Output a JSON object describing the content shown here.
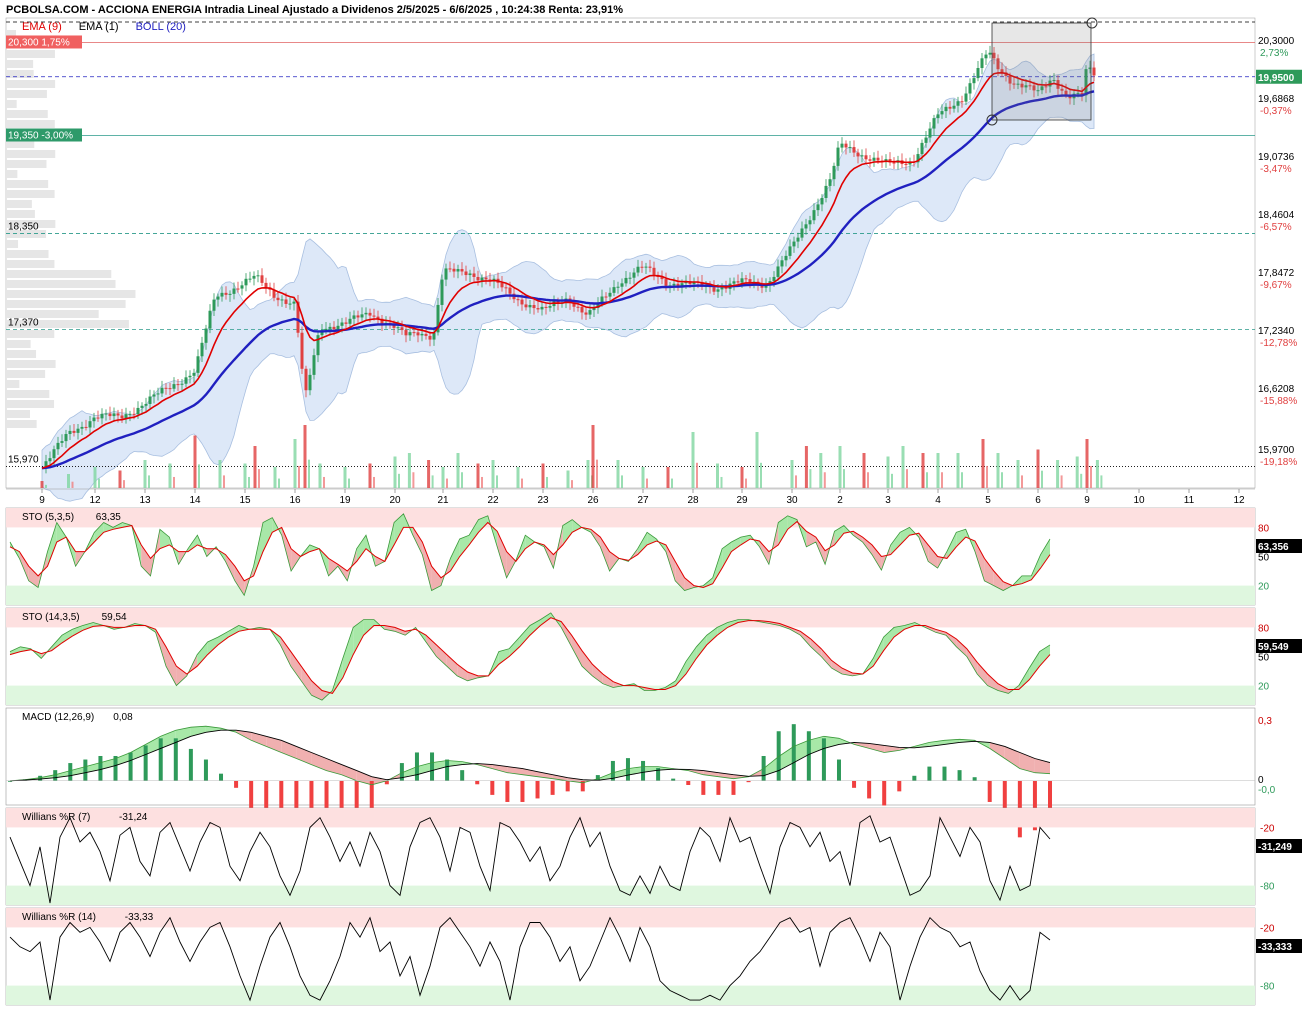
{
  "header": {
    "title": "PCBOLSA.COM - ACCIONA ENERGIA Intradia Lineal Ajustado a Dividenos 2/5/2025 - 6/6/2025 , 10:24:38 Renta: 23,91%"
  },
  "legend": [
    {
      "label": "EMA (9)",
      "color": "#e00000"
    },
    {
      "label": "EMA (1)",
      "color": "#000000"
    },
    {
      "label": "BOLL (20)",
      "color": "#2020c0"
    }
  ],
  "colors": {
    "up": "#2e9a5a",
    "down": "#e04040",
    "ema9": "#e00000",
    "ema_slow": "#2020c0",
    "boll_fill": "#dde8f8",
    "boll_edge": "#a8bfe0",
    "overbought": "#fde0e0",
    "oversold": "#dff7df",
    "grid_text": "#000000"
  },
  "chart_data": [
    {
      "type": "line",
      "name": "price",
      "ylim": [
        15.75,
        20.55
      ],
      "price_ticks": [
        "20,3000",
        "19,6868",
        "19,0736",
        "18,4604",
        "17,8472",
        "17,2340",
        "16,6208",
        "15,9700"
      ],
      "pct_ticks": [
        "2,73%",
        "-0,37%",
        "-3,47%",
        "-6,57%",
        "-9,67%",
        "-12,78%",
        "-15,88%",
        "-19,18%"
      ],
      "current_price": "19,9500",
      "x_labels": [
        "9",
        "12",
        "13",
        "14",
        "15",
        "16",
        "19",
        "20",
        "21",
        "22",
        "23",
        "26",
        "27",
        "28",
        "29",
        "30",
        "2",
        "3",
        "4",
        "5",
        "6",
        "9",
        "10",
        "11",
        "12"
      ],
      "left_levels": [
        {
          "label": "20,300  1,75%",
          "value": 20.3,
          "style": "red-solid"
        },
        {
          "label": "19,350  -3,00%",
          "value": 19.35,
          "style": "green-solid"
        },
        {
          "label": "18,350",
          "value": 18.35,
          "style": "dashed"
        },
        {
          "label": "17,370",
          "value": 17.37,
          "style": "dashed"
        },
        {
          "label": "15,970",
          "value": 15.97,
          "style": "dotted"
        }
      ],
      "closes": [
        [
          0,
          15.97
        ],
        [
          0.5,
          16.3
        ],
        [
          1,
          16.48
        ],
        [
          1.5,
          16.47
        ],
        [
          2,
          16.62
        ],
        [
          2.5,
          16.78
        ],
        [
          3,
          16.95
        ],
        [
          3.4,
          17.7
        ],
        [
          3.8,
          17.8
        ],
        [
          4.2,
          17.9
        ],
        [
          4.6,
          17.72
        ],
        [
          5,
          17.62
        ],
        [
          5.2,
          16.65
        ],
        [
          5.5,
          17.4
        ],
        [
          6,
          17.42
        ],
        [
          6.5,
          17.55
        ],
        [
          7,
          17.38
        ],
        [
          7.2,
          17.3
        ],
        [
          7.5,
          17.35
        ],
        [
          7.8,
          17.3
        ],
        [
          8,
          17.95
        ],
        [
          8.5,
          17.96
        ],
        [
          9,
          17.85
        ],
        [
          9.5,
          17.68
        ],
        [
          10,
          17.55
        ],
        [
          10.5,
          17.7
        ],
        [
          10.9,
          17.5
        ],
        [
          11,
          17.56
        ],
        [
          11.5,
          17.85
        ],
        [
          12,
          18.0
        ],
        [
          12.5,
          17.85
        ],
        [
          13,
          17.82
        ],
        [
          13.5,
          17.8
        ],
        [
          14,
          17.85
        ],
        [
          14.5,
          17.84
        ],
        [
          15,
          18.2
        ],
        [
          15.4,
          18.55
        ],
        [
          15.8,
          18.9
        ],
        [
          16,
          19.25
        ],
        [
          16.5,
          19.15
        ],
        [
          17,
          19.05
        ],
        [
          17.5,
          19.1
        ],
        [
          18,
          19.55
        ],
        [
          18.5,
          19.75
        ],
        [
          19,
          20.2
        ],
        [
          19.2,
          20.05
        ],
        [
          19.5,
          19.9
        ],
        [
          19.8,
          19.83
        ],
        [
          20,
          19.78
        ],
        [
          20.3,
          19.95
        ],
        [
          20.6,
          19.75
        ],
        [
          20.9,
          19.75
        ],
        [
          21.0,
          20.05
        ],
        [
          21.2,
          19.95
        ]
      ],
      "volumes": [
        [
          0,
          0.1
        ],
        [
          0.5,
          0.2
        ],
        [
          1,
          0.3
        ],
        [
          1.5,
          0.25
        ],
        [
          2,
          0.4
        ],
        [
          2.5,
          0.35
        ],
        [
          3,
          0.75
        ],
        [
          3.5,
          0.4
        ],
        [
          4,
          0.35
        ],
        [
          4.2,
          0.6
        ],
        [
          4.6,
          0.3
        ],
        [
          5,
          0.7
        ],
        [
          5.2,
          0.9
        ],
        [
          5.5,
          0.35
        ],
        [
          6,
          0.3
        ],
        [
          6.5,
          0.35
        ],
        [
          7,
          0.45
        ],
        [
          7.3,
          0.5
        ],
        [
          7.7,
          0.4
        ],
        [
          8,
          0.3
        ],
        [
          8.3,
          0.5
        ],
        [
          8.7,
          0.35
        ],
        [
          9,
          0.4
        ],
        [
          9.5,
          0.3
        ],
        [
          10,
          0.35
        ],
        [
          10.5,
          0.25
        ],
        [
          10.9,
          0.4
        ],
        [
          11,
          0.9
        ],
        [
          11.5,
          0.4
        ],
        [
          12,
          0.3
        ],
        [
          12.5,
          0.3
        ],
        [
          13,
          0.8
        ],
        [
          13.5,
          0.35
        ],
        [
          14,
          0.3
        ],
        [
          14.3,
          0.8
        ],
        [
          15,
          0.4
        ],
        [
          15.3,
          0.6
        ],
        [
          15.6,
          0.5
        ],
        [
          16,
          0.6
        ],
        [
          16.5,
          0.5
        ],
        [
          17,
          0.45
        ],
        [
          17.3,
          0.6
        ],
        [
          17.7,
          0.5
        ],
        [
          18,
          0.5
        ],
        [
          18.4,
          0.5
        ],
        [
          18.9,
          0.7
        ],
        [
          19.2,
          0.5
        ],
        [
          19.6,
          0.4
        ],
        [
          20,
          0.55
        ],
        [
          20.4,
          0.4
        ],
        [
          20.8,
          0.45
        ],
        [
          21.0,
          0.7
        ],
        [
          21.2,
          0.4
        ]
      ],
      "last_move": "down"
    },
    {
      "type": "line",
      "name": "STO (5,3,5)",
      "label": "STO (5,3,5)",
      "value_label": "63,35",
      "current": "63,356",
      "ylim": [
        0,
        100
      ],
      "levels": [
        "80",
        "50",
        "20"
      ],
      "k": [
        65,
        48,
        25,
        18,
        55,
        85,
        70,
        40,
        55,
        75,
        85,
        80,
        85,
        82,
        40,
        30,
        78,
        70,
        42,
        58,
        72,
        50,
        60,
        45,
        25,
        10,
        40,
        85,
        90,
        72,
        35,
        50,
        62,
        58,
        30,
        40,
        25,
        58,
        72,
        40,
        45,
        85,
        94,
        72,
        52,
        15,
        20,
        48,
        68,
        72,
        88,
        92,
        60,
        28,
        46,
        72,
        65,
        60,
        38,
        82,
        88,
        80,
        75,
        60,
        35,
        48,
        45,
        58,
        75,
        68,
        55,
        25,
        15,
        18,
        20,
        28,
        58,
        65,
        70,
        72,
        60,
        42,
        85,
        92,
        88,
        60,
        65,
        42,
        76,
        82,
        72,
        65,
        52,
        36,
        62,
        75,
        80,
        70,
        45,
        38,
        55,
        75,
        78,
        55,
        25,
        20,
        15,
        20,
        30,
        30,
        52,
        68
      ],
      "d": [
        60,
        55,
        40,
        30,
        40,
        65,
        70,
        55,
        55,
        65,
        75,
        78,
        80,
        82,
        62,
        48,
        58,
        62,
        55,
        55,
        62,
        58,
        58,
        52,
        40,
        25,
        30,
        55,
        75,
        80,
        58,
        50,
        55,
        58,
        48,
        42,
        35,
        45,
        58,
        50,
        45,
        62,
        80,
        80,
        65,
        40,
        28,
        35,
        50,
        62,
        75,
        85,
        76,
        55,
        45,
        58,
        65,
        62,
        52,
        62,
        75,
        80,
        78,
        70,
        55,
        48,
        46,
        52,
        62,
        66,
        62,
        45,
        28,
        20,
        18,
        22,
        38,
        55,
        62,
        68,
        66,
        55,
        62,
        78,
        86,
        76,
        70,
        56,
        62,
        74,
        76,
        70,
        62,
        50,
        52,
        62,
        72,
        74,
        62,
        50,
        48,
        60,
        70,
        66,
        48,
        35,
        24,
        20,
        22,
        26,
        38,
        52
      ]
    },
    {
      "type": "line",
      "name": "STO (14,3,5)",
      "label": "STO (14,3,5)",
      "value_label": "59,54",
      "current": "59,549",
      "ylim": [
        0,
        100
      ],
      "levels": [
        "80",
        "50",
        "20"
      ],
      "k": [
        55,
        60,
        58,
        48,
        60,
        72,
        78,
        82,
        85,
        82,
        78,
        80,
        84,
        82,
        75,
        40,
        20,
        30,
        52,
        65,
        70,
        76,
        82,
        78,
        80,
        78,
        62,
        40,
        25,
        10,
        5,
        15,
        48,
        80,
        88,
        88,
        78,
        76,
        72,
        80,
        65,
        50,
        40,
        30,
        25,
        28,
        30,
        55,
        58,
        70,
        82,
        88,
        95,
        80,
        60,
        40,
        30,
        22,
        18,
        20,
        22,
        15,
        15,
        18,
        25,
        45,
        60,
        72,
        80,
        85,
        88,
        88,
        86,
        84,
        82,
        78,
        72,
        60,
        50,
        38,
        32,
        30,
        32,
        48,
        70,
        80,
        82,
        85,
        80,
        75,
        72,
        60,
        50,
        32,
        20,
        15,
        12,
        20,
        38,
        55,
        62
      ],
      "d": [
        52,
        55,
        57,
        53,
        56,
        64,
        71,
        77,
        81,
        82,
        80,
        80,
        82,
        82,
        78,
        60,
        40,
        32,
        40,
        52,
        62,
        70,
        76,
        78,
        78,
        78,
        70,
        55,
        40,
        25,
        15,
        12,
        28,
        52,
        72,
        82,
        82,
        80,
        76,
        78,
        72,
        62,
        52,
        42,
        34,
        30,
        30,
        42,
        50,
        60,
        72,
        82,
        90,
        86,
        72,
        56,
        42,
        32,
        24,
        20,
        20,
        18,
        16,
        16,
        20,
        32,
        48,
        62,
        72,
        80,
        85,
        87,
        87,
        86,
        84,
        80,
        76,
        68,
        58,
        46,
        38,
        33,
        32,
        40,
        56,
        70,
        78,
        82,
        82,
        78,
        75,
        68,
        58,
        44,
        32,
        22,
        16,
        16,
        26,
        40,
        52
      ]
    },
    {
      "type": "area",
      "name": "MACD (12,26,9)",
      "label": "MACD (12,26,9)",
      "value_label": "0,08",
      "top_tick": "0,3",
      "zero_tick": "0",
      "current": "-0,0",
      "ylim": [
        -0.12,
        0.36
      ],
      "macd": [
        0.0,
        0.005,
        0.015,
        0.03,
        0.05,
        0.07,
        0.09,
        0.11,
        0.14,
        0.18,
        0.22,
        0.25,
        0.265,
        0.27,
        0.26,
        0.24,
        0.2,
        0.17,
        0.14,
        0.11,
        0.08,
        0.05,
        0.03,
        0.0,
        -0.02,
        0.0,
        0.04,
        0.07,
        0.09,
        0.1,
        0.095,
        0.08,
        0.06,
        0.04,
        0.03,
        0.02,
        0.01,
        0.0,
        -0.01,
        0.01,
        0.04,
        0.06,
        0.07,
        0.07,
        0.06,
        0.05,
        0.03,
        0.02,
        0.01,
        0.02,
        0.06,
        0.12,
        0.17,
        0.2,
        0.22,
        0.21,
        0.18,
        0.16,
        0.14,
        0.15,
        0.17,
        0.19,
        0.2,
        0.205,
        0.2,
        0.16,
        0.11,
        0.06,
        0.04,
        0.035
      ],
      "signal": [
        0.0,
        0.003,
        0.008,
        0.015,
        0.025,
        0.04,
        0.055,
        0.075,
        0.1,
        0.13,
        0.16,
        0.19,
        0.22,
        0.24,
        0.25,
        0.25,
        0.24,
        0.22,
        0.2,
        0.17,
        0.14,
        0.11,
        0.08,
        0.05,
        0.02,
        0.005,
        0.015,
        0.03,
        0.05,
        0.07,
        0.08,
        0.085,
        0.08,
        0.07,
        0.06,
        0.045,
        0.03,
        0.015,
        0.005,
        0.002,
        0.012,
        0.028,
        0.042,
        0.052,
        0.057,
        0.056,
        0.05,
        0.04,
        0.03,
        0.022,
        0.025,
        0.05,
        0.09,
        0.13,
        0.16,
        0.18,
        0.19,
        0.185,
        0.175,
        0.165,
        0.163,
        0.17,
        0.18,
        0.19,
        0.195,
        0.19,
        0.17,
        0.14,
        0.11,
        0.09
      ]
    },
    {
      "type": "line",
      "name": "Willians %R (7)",
      "label": "Willians %R (7)",
      "value_label": "-31,24",
      "current": "-31,249",
      "ylim": [
        -100,
        0
      ],
      "levels": [
        "-20",
        "-80"
      ],
      "values": [
        -30,
        -55,
        -80,
        -40,
        -98,
        -30,
        -10,
        -35,
        -25,
        -45,
        -75,
        -28,
        -20,
        -55,
        -70,
        -25,
        -15,
        -40,
        -65,
        -35,
        -15,
        -20,
        -60,
        -75,
        -45,
        -25,
        -40,
        -70,
        -90,
        -65,
        -20,
        -10,
        -30,
        -55,
        -35,
        -60,
        -25,
        -45,
        -80,
        -90,
        -40,
        -15,
        -10,
        -30,
        -65,
        -20,
        -25,
        -60,
        -85,
        -15,
        -20,
        -35,
        -55,
        -40,
        -75,
        -60,
        -30,
        -10,
        -40,
        -25,
        -60,
        -85,
        -90,
        -70,
        -88,
        -60,
        -80,
        -85,
        -45,
        -20,
        -30,
        -55,
        -10,
        -35,
        -30,
        -60,
        -88,
        -40,
        -15,
        -20,
        -40,
        -25,
        -55,
        -45,
        -80,
        -15,
        -8,
        -35,
        -30,
        -60,
        -90,
        -85,
        -70,
        -10,
        -30,
        -50,
        -20,
        -35,
        -75,
        -95,
        -60,
        -85,
        -80,
        -20,
        -32
      ]
    },
    {
      "type": "line",
      "name": "Willians %R (14)",
      "label": "Willians %R (14)",
      "value_label": "-33,33",
      "current": "-33,333",
      "ylim": [
        -100,
        0
      ],
      "levels": [
        "-20",
        "-80"
      ],
      "values": [
        -30,
        -40,
        -45,
        -35,
        -95,
        -30,
        -15,
        -25,
        -20,
        -35,
        -55,
        -25,
        -15,
        -30,
        -50,
        -25,
        -10,
        -35,
        -55,
        -35,
        -20,
        -15,
        -40,
        -70,
        -95,
        -60,
        -30,
        -15,
        -40,
        -70,
        -90,
        -95,
        -75,
        -50,
        -15,
        -30,
        -10,
        -45,
        -35,
        -70,
        -50,
        -90,
        -60,
        -20,
        -10,
        -25,
        -40,
        -60,
        -35,
        -55,
        -95,
        -40,
        -15,
        -15,
        -30,
        -55,
        -40,
        -75,
        -60,
        -35,
        -10,
        -30,
        -55,
        -20,
        -40,
        -75,
        -85,
        -90,
        -95,
        -95,
        -90,
        -95,
        -80,
        -70,
        -55,
        -45,
        -30,
        -15,
        -10,
        -25,
        -20,
        -60,
        -25,
        -15,
        -10,
        -30,
        -55,
        -25,
        -40,
        -95,
        -60,
        -30,
        -10,
        -20,
        -25,
        -40,
        -35,
        -65,
        -85,
        -95,
        -80,
        -95,
        -85,
        -25,
        -33
      ]
    }
  ]
}
